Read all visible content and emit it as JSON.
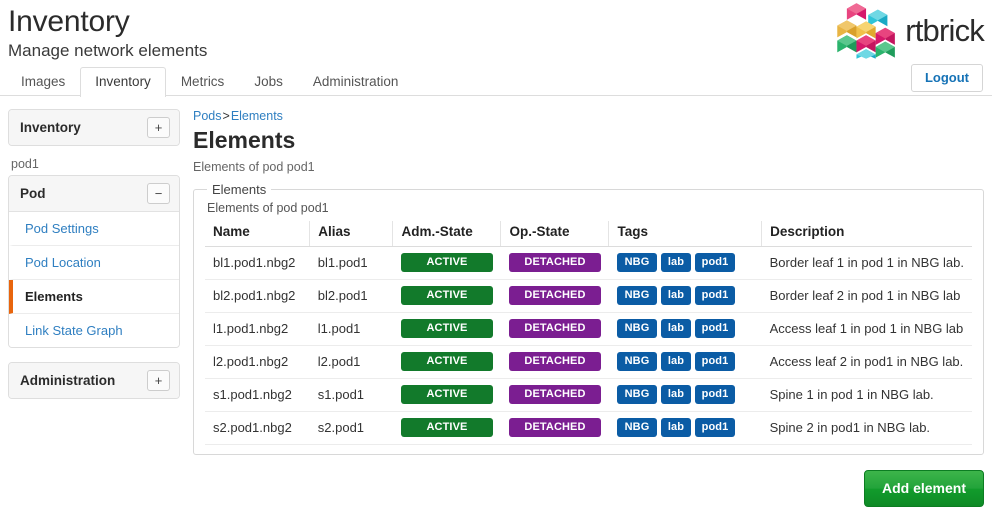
{
  "header": {
    "title": "Inventory",
    "subtitle": "Manage network elements",
    "brand_name": "rtbrick",
    "logout_label": "Logout"
  },
  "tabs": [
    {
      "label": "Images",
      "active": false
    },
    {
      "label": "Inventory",
      "active": true
    },
    {
      "label": "Metrics",
      "active": false
    },
    {
      "label": "Jobs",
      "active": false
    },
    {
      "label": "Administration",
      "active": false
    }
  ],
  "sidebar": {
    "inventory_panel": {
      "title": "Inventory",
      "toggle": "+"
    },
    "group_label": "pod1",
    "pod_panel": {
      "title": "Pod",
      "toggle": "−",
      "items": [
        {
          "label": "Pod Settings",
          "active": false
        },
        {
          "label": "Pod Location",
          "active": false
        },
        {
          "label": "Elements",
          "active": true
        },
        {
          "label": "Link State Graph",
          "active": false
        }
      ]
    },
    "administration_panel": {
      "title": "Administration",
      "toggle": "+"
    }
  },
  "main": {
    "breadcrumb": {
      "root": "Pods",
      "separator": ">",
      "current": "Elements"
    },
    "title": "Elements",
    "description": "Elements of pod pod1",
    "card": {
      "legend": "Elements",
      "description": "Elements of pod pod1"
    },
    "table": {
      "columns": [
        "Name",
        "Alias",
        "Adm.-State",
        "Op.-State",
        "Tags",
        "Description"
      ],
      "rows": [
        {
          "name": "bl1.pod1.nbg2",
          "alias": "bl1.pod1",
          "adm_state": "ACTIVE",
          "op_state": "DETACHED",
          "tags": [
            "NBG",
            "lab",
            "pod1"
          ],
          "description": "Border leaf 1 in pod 1 in NBG lab."
        },
        {
          "name": "bl2.pod1.nbg2",
          "alias": "bl2.pod1",
          "adm_state": "ACTIVE",
          "op_state": "DETACHED",
          "tags": [
            "NBG",
            "lab",
            "pod1"
          ],
          "description": "Border leaf 2 in pod 1 in NBG lab"
        },
        {
          "name": "l1.pod1.nbg2",
          "alias": "l1.pod1",
          "adm_state": "ACTIVE",
          "op_state": "DETACHED",
          "tags": [
            "NBG",
            "lab",
            "pod1"
          ],
          "description": "Access leaf 1 in pod 1 in NBG lab"
        },
        {
          "name": "l2.pod1.nbg2",
          "alias": "l2.pod1",
          "adm_state": "ACTIVE",
          "op_state": "DETACHED",
          "tags": [
            "NBG",
            "lab",
            "pod1"
          ],
          "description": "Access leaf 2 in pod1 in NBG lab."
        },
        {
          "name": "s1.pod1.nbg2",
          "alias": "s1.pod1",
          "adm_state": "ACTIVE",
          "op_state": "DETACHED",
          "tags": [
            "NBG",
            "lab",
            "pod1"
          ],
          "description": "Spine 1 in pod 1 in NBG lab."
        },
        {
          "name": "s2.pod1.nbg2",
          "alias": "s2.pod1",
          "adm_state": "ACTIVE",
          "op_state": "DETACHED",
          "tags": [
            "NBG",
            "lab",
            "pod1"
          ],
          "description": "Spine 2 in pod1 in NBG lab."
        }
      ]
    },
    "add_element_label": "Add element"
  },
  "colors": {
    "state_active": "#127a2b",
    "state_detached": "#7b1e91",
    "tag": "#0b5ca5",
    "link": "#2f7fc1",
    "active_nav_marker": "#e8650d",
    "primary_button": "#22a33a"
  }
}
